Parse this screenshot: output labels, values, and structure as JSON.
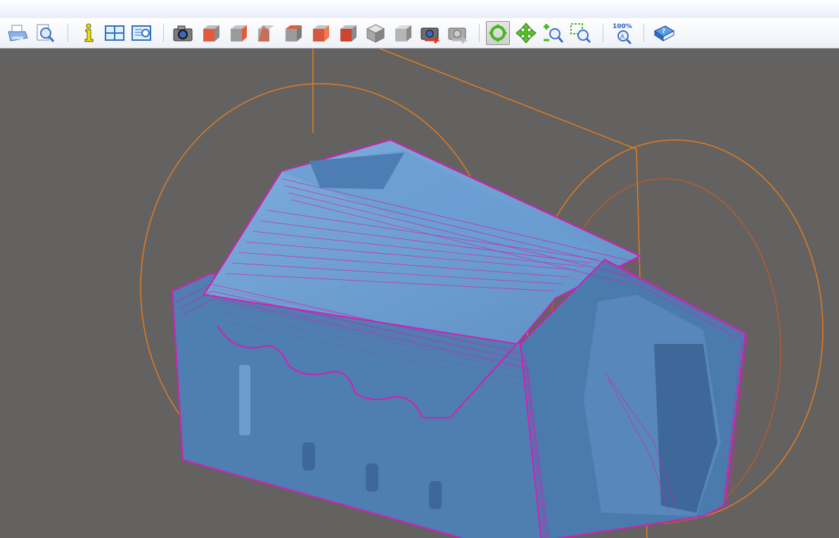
{
  "toolbar": {
    "buttons": [
      {
        "name": "print-button",
        "icon": "printer-icon"
      },
      {
        "name": "print-preview-button",
        "icon": "print-preview-icon"
      },
      {
        "name": "info-button",
        "icon": "info-icon"
      },
      {
        "name": "layout-view-button",
        "icon": "grid-view-icon"
      },
      {
        "name": "document-view-button",
        "icon": "document-view-icon"
      },
      {
        "name": "snapshot-button",
        "icon": "camera-icon"
      },
      {
        "name": "view-front-button",
        "icon": "cube-front-icon"
      },
      {
        "name": "view-right-button",
        "icon": "cube-right-icon"
      },
      {
        "name": "view-back-button",
        "icon": "cube-back-icon"
      },
      {
        "name": "view-top-button",
        "icon": "cube-top-icon"
      },
      {
        "name": "view-left-button",
        "icon": "cube-left-icon"
      },
      {
        "name": "view-bottom-button",
        "icon": "cube-bottom-icon"
      },
      {
        "name": "view-iso-button",
        "icon": "cube-iso-icon"
      },
      {
        "name": "view-iso-alt-button",
        "icon": "cube-iso-alt-icon"
      },
      {
        "name": "camera-reset-button",
        "icon": "camera-reset-icon"
      },
      {
        "name": "camera-forward-button",
        "icon": "camera-forward-icon"
      },
      {
        "name": "rotate-button",
        "icon": "rotate-icon",
        "active": true
      },
      {
        "name": "pan-button",
        "icon": "pan-icon"
      },
      {
        "name": "zoom-button",
        "icon": "zoom-icon"
      },
      {
        "name": "zoom-window-button",
        "icon": "zoom-window-icon"
      },
      {
        "name": "zoom-fit-button",
        "icon": "zoom-100-icon",
        "label": "100%"
      },
      {
        "name": "help-button",
        "icon": "help-book-icon"
      }
    ]
  },
  "colors": {
    "viewport_bg": "#646261",
    "part": "#6f9fcf",
    "toolpath": "#d21fb4",
    "bounds": "#e07c1e"
  }
}
